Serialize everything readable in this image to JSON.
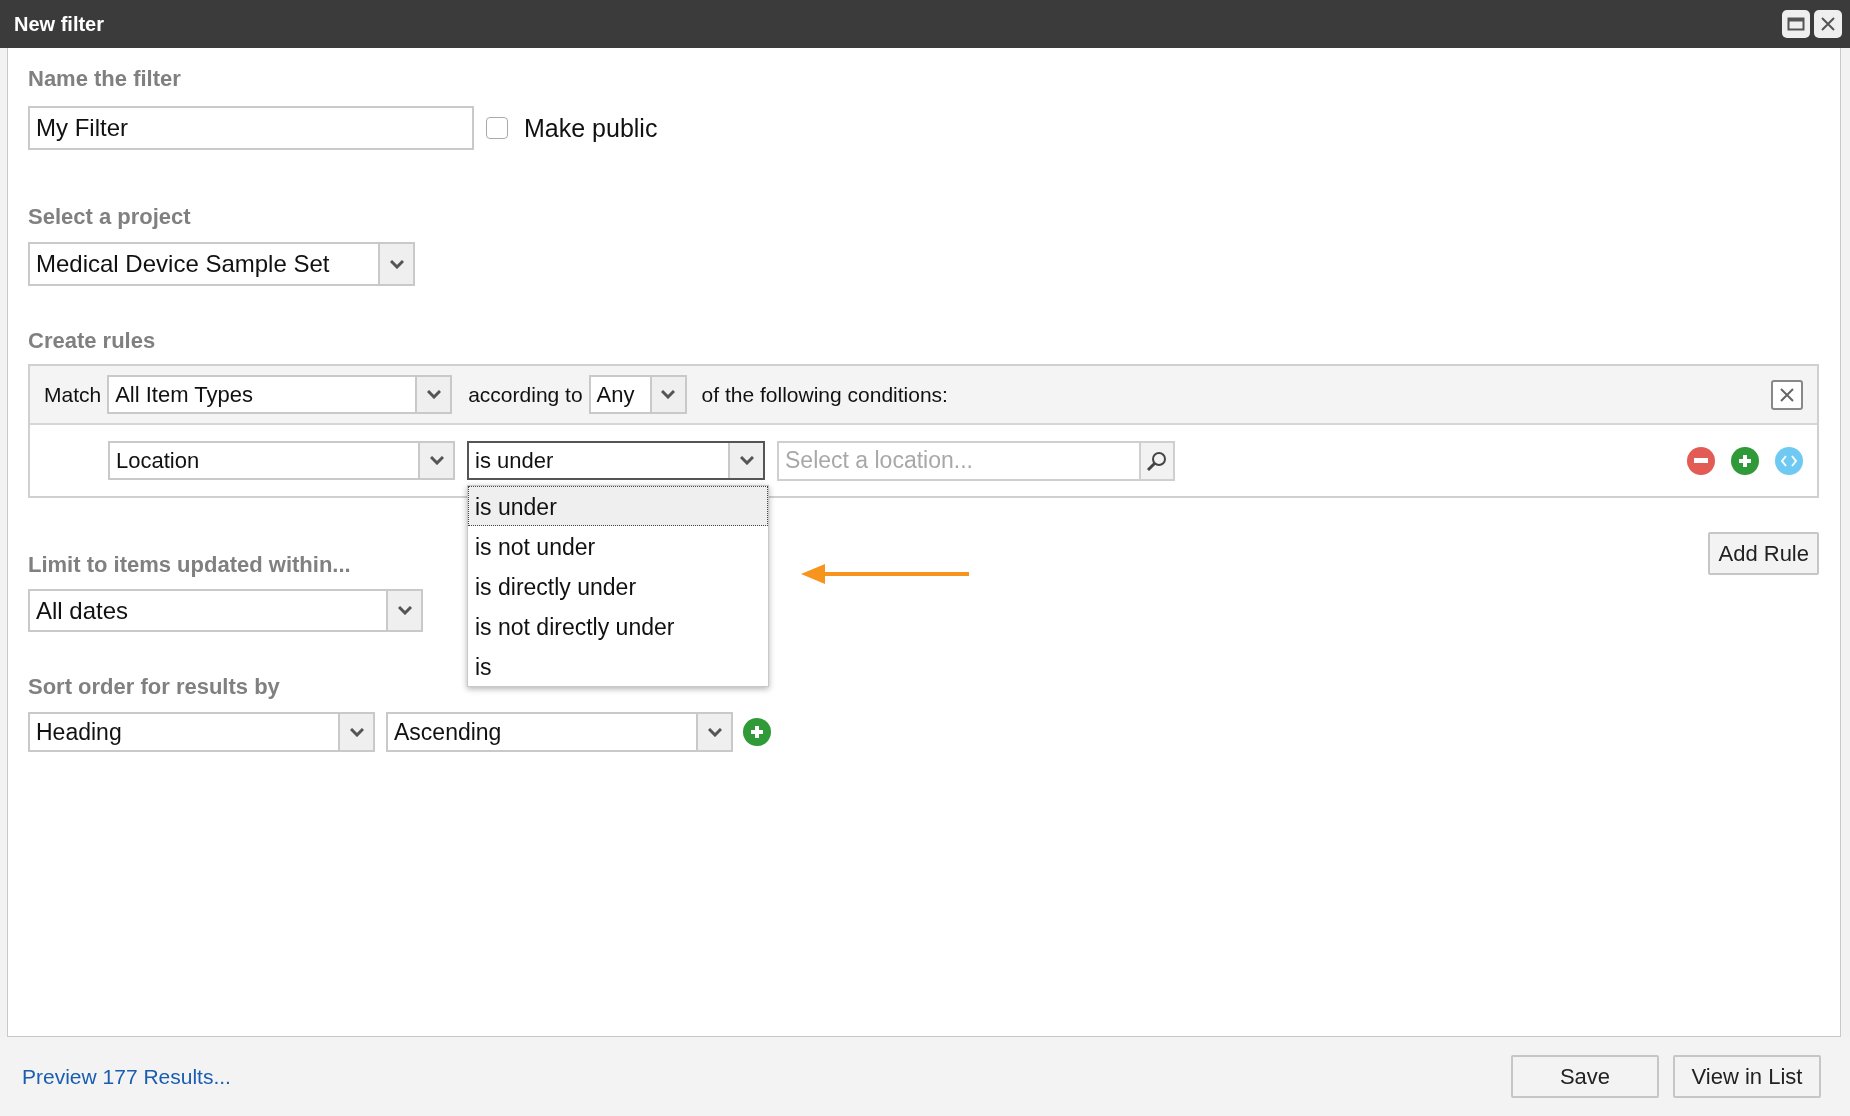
{
  "window": {
    "title": "New filter"
  },
  "name_section": {
    "label": "Name the filter",
    "value": "My Filter",
    "make_public": {
      "label": "Make public",
      "checked": false
    }
  },
  "project_section": {
    "label": "Select a project",
    "value": "Medical Device Sample Set"
  },
  "rules_section": {
    "label": "Create rules",
    "match_label": "Match",
    "item_type": "All Item Types",
    "according_label": "according to",
    "mode": "Any",
    "conditions_label": "of the following conditions:",
    "rules": [
      {
        "field": "Location",
        "operator": "is under",
        "operator_expanded": true,
        "location_placeholder": "Select a location..."
      }
    ],
    "operator_options": [
      {
        "label": "is under",
        "selected": true
      },
      {
        "label": "is not under",
        "selected": false
      },
      {
        "label": "is directly under",
        "selected": false
      },
      {
        "label": "is not directly under",
        "selected": false
      },
      {
        "label": "is",
        "selected": false
      }
    ],
    "add_rule": "Add Rule"
  },
  "limit_section": {
    "label": "Limit to items updated within...",
    "value": "All dates"
  },
  "sort_section": {
    "label": "Sort order for results by",
    "field": "Heading",
    "direction": "Ascending"
  },
  "footer": {
    "preview_link": "Preview 177 Results...",
    "buttons": [
      "Save",
      "View in List"
    ]
  }
}
